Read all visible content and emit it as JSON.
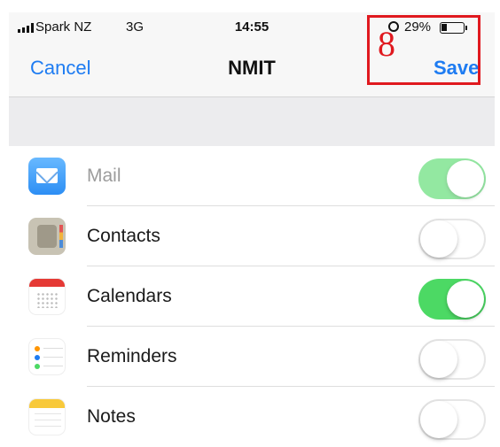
{
  "status_bar": {
    "carrier": "Spark NZ",
    "network": "3G",
    "time": "14:55",
    "battery": "29%"
  },
  "nav": {
    "cancel_label": "Cancel",
    "title": "NMIT",
    "save_label": "Save"
  },
  "annotation": {
    "number": "8",
    "color": "#e0191f"
  },
  "sync_items": [
    {
      "label": "Mail",
      "icon": "mail-icon",
      "enabled": true,
      "disabled": true
    },
    {
      "label": "Contacts",
      "icon": "contacts-icon",
      "enabled": false,
      "disabled": false
    },
    {
      "label": "Calendars",
      "icon": "calendar-icon",
      "enabled": true,
      "disabled": false
    },
    {
      "label": "Reminders",
      "icon": "reminders-icon",
      "enabled": false,
      "disabled": false
    },
    {
      "label": "Notes",
      "icon": "notes-icon",
      "enabled": false,
      "disabled": false
    }
  ],
  "colors": {
    "accent": "#1e7cf2",
    "toggle_on": "#4cd964"
  }
}
